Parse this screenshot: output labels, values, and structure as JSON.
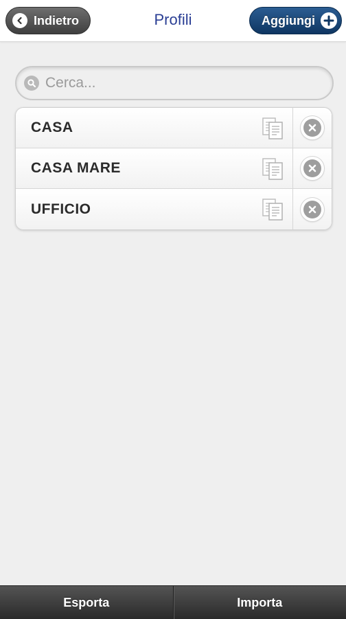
{
  "header": {
    "back_label": "Indietro",
    "title": "Profili",
    "add_label": "Aggiungi"
  },
  "search": {
    "placeholder": "Cerca..."
  },
  "profiles": [
    {
      "name": "CASA",
      "copy_icon": "copy-icon",
      "delete_icon": "delete-icon"
    },
    {
      "name": "CASA MARE",
      "copy_icon": "copy-icon",
      "delete_icon": "delete-icon"
    },
    {
      "name": "UFFICIO",
      "copy_icon": "copy-icon",
      "delete_icon": "delete-icon"
    }
  ],
  "footer": {
    "export_label": "Esporta",
    "import_label": "Importa"
  },
  "colors": {
    "title": "#2a3e94",
    "add_button": "#1a4676",
    "back_button": "#555555",
    "background": "#efefef",
    "footer": "#3a3a3a"
  }
}
